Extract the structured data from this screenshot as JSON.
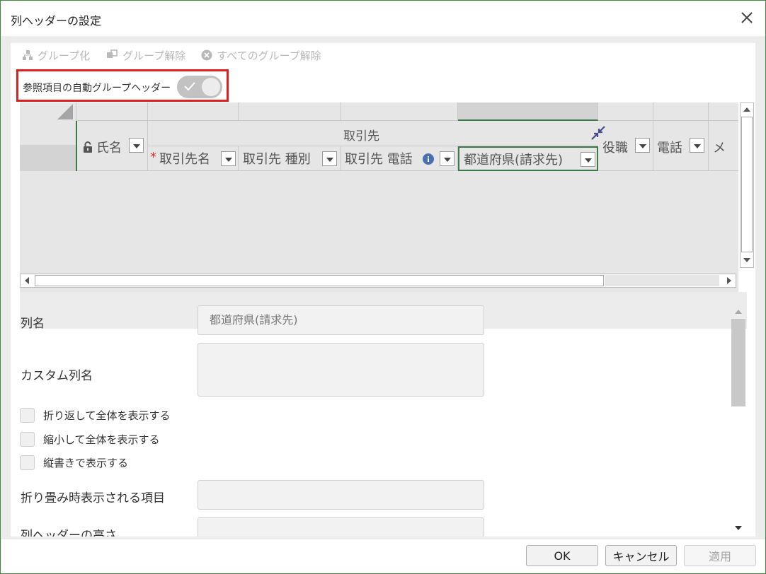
{
  "dialog": {
    "title": "列ヘッダーの設定"
  },
  "toolbar": {
    "group": "グループ化",
    "ungroup": "グループ解除",
    "ungroup_all": "すべてのグループ解除"
  },
  "auto_group": {
    "label": "参照項目の自動グループヘッダー",
    "enabled": true
  },
  "grid": {
    "group_header": "取引先",
    "columns": [
      {
        "label": "氏名",
        "locked": true
      },
      {
        "label": "取引先名",
        "required": true
      },
      {
        "label": "取引先 種別"
      },
      {
        "label": "取引先 電話",
        "info": true
      },
      {
        "label": "都道府県(請求先)",
        "selected": true
      },
      {
        "label": "役職"
      },
      {
        "label": "電話"
      },
      {
        "label": "メ"
      }
    ]
  },
  "form": {
    "column_name_label": "列名",
    "column_name_value": "都道府県(請求先)",
    "custom_name_label": "カスタム列名",
    "custom_name_value": "",
    "checkboxes": [
      {
        "label": "折り返して全体を表示する",
        "checked": false
      },
      {
        "label": "縮小して全体を表示する",
        "checked": false
      },
      {
        "label": "縦書きで表示する",
        "checked": false
      }
    ],
    "collapsed_label": "折り畳み時表示される項目",
    "collapsed_value": "",
    "header_height_label": "列ヘッダーの高さ",
    "header_height_value": ""
  },
  "footer": {
    "ok": "OK",
    "cancel": "キャンセル",
    "apply": "適用"
  },
  "colors": {
    "accent_green": "#3c7a4a",
    "highlight_red": "#e02020",
    "required_red": "#e03030",
    "info_blue": "#4a6fb0"
  }
}
